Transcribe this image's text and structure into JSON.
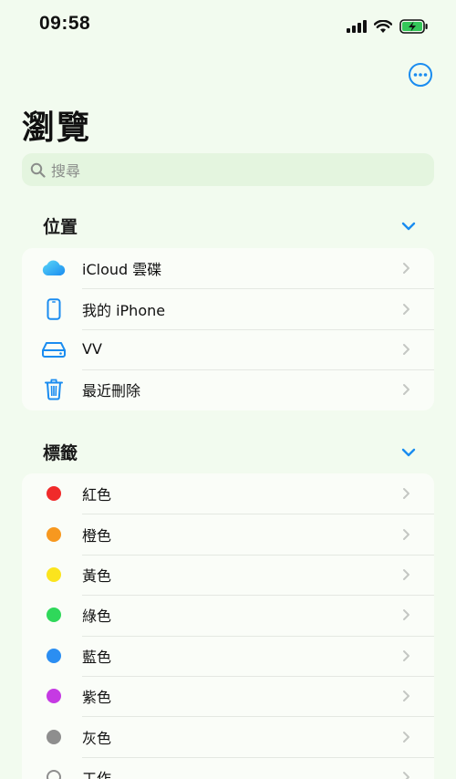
{
  "status": {
    "time": "09:58"
  },
  "header": {
    "title": "瀏覽"
  },
  "search": {
    "placeholder": "搜尋"
  },
  "sections": {
    "locations": {
      "title": "位置",
      "items": [
        {
          "label": "iCloud 雲碟",
          "icon": "icloud-icon"
        },
        {
          "label": "我的 iPhone",
          "icon": "iphone-icon"
        },
        {
          "label": "VV",
          "icon": "drive-icon"
        },
        {
          "label": "最近刪除",
          "icon": "trash-icon"
        }
      ]
    },
    "tags": {
      "title": "標籤",
      "items": [
        {
          "label": "紅色",
          "color": "#f02a2a"
        },
        {
          "label": "橙色",
          "color": "#f7981f"
        },
        {
          "label": "黃色",
          "color": "#fbe41d"
        },
        {
          "label": "綠色",
          "color": "#2fd85a"
        },
        {
          "label": "藍色",
          "color": "#2b8ef2"
        },
        {
          "label": "紫色",
          "color": "#c53ae3"
        },
        {
          "label": "灰色",
          "color": "#8e8e8e"
        },
        {
          "label": "工作",
          "color": "outline"
        }
      ]
    }
  },
  "colors": {
    "accent": "#1a8cf0",
    "background": "#f2fbef"
  }
}
